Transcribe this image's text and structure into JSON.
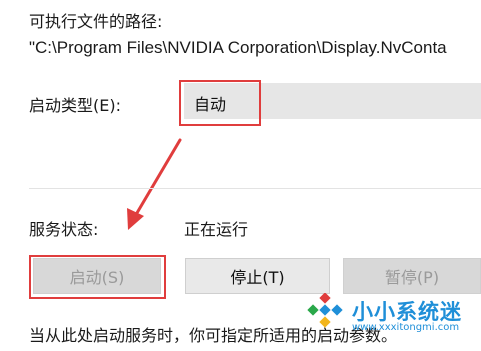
{
  "exe_path": {
    "label": "可执行文件的路径:",
    "value": "\"C:\\Program Files\\NVIDIA Corporation\\Display.NvConta"
  },
  "startup_type": {
    "label": "启动类型(E):",
    "selected": "自动"
  },
  "service_status": {
    "label": "服务状态:",
    "value": "正在运行"
  },
  "buttons": {
    "start": "启动(S)",
    "stop": "停止(T)",
    "pause": "暂停(P)"
  },
  "note": "当从此处启动服务时，你可指定所适用的启动参数。",
  "watermark": {
    "name": "小小系统迷",
    "url": "www.xxxitongmi.com"
  },
  "colors": {
    "highlight": "#e03d3d",
    "watermark": "#1f8fd8"
  }
}
